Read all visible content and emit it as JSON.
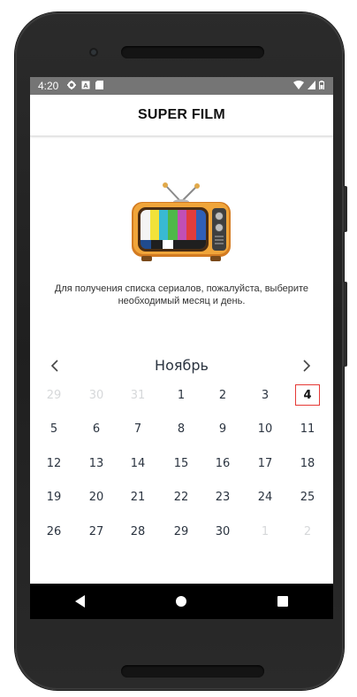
{
  "status_bar": {
    "time": "4:20",
    "left_icons": [
      "settings-icon",
      "a-icon",
      "sd-card-icon"
    ],
    "right_icons": [
      "wifi-icon",
      "signal-icon",
      "battery-icon"
    ]
  },
  "app_bar": {
    "title": "SUPER FILM"
  },
  "instruction_text": "Для получения списка сериалов, пожалуйста, выберите необходимый месяц и день.",
  "calendar": {
    "month": "Ноябрь",
    "prev_label": "<",
    "next_label": ">",
    "selected_day": "4",
    "weeks": [
      [
        {
          "d": "29",
          "dim": true
        },
        {
          "d": "30",
          "dim": true
        },
        {
          "d": "31",
          "dim": true
        },
        {
          "d": "1"
        },
        {
          "d": "2"
        },
        {
          "d": "3"
        },
        {
          "d": "4",
          "sel": true
        }
      ],
      [
        {
          "d": "5"
        },
        {
          "d": "6"
        },
        {
          "d": "7"
        },
        {
          "d": "8"
        },
        {
          "d": "9"
        },
        {
          "d": "10"
        },
        {
          "d": "11"
        }
      ],
      [
        {
          "d": "12"
        },
        {
          "d": "13"
        },
        {
          "d": "14"
        },
        {
          "d": "15"
        },
        {
          "d": "16"
        },
        {
          "d": "17"
        },
        {
          "d": "18"
        }
      ],
      [
        {
          "d": "19"
        },
        {
          "d": "20"
        },
        {
          "d": "21"
        },
        {
          "d": "22"
        },
        {
          "d": "23"
        },
        {
          "d": "24"
        },
        {
          "d": "25"
        }
      ],
      [
        {
          "d": "26"
        },
        {
          "d": "27"
        },
        {
          "d": "28"
        },
        {
          "d": "29"
        },
        {
          "d": "30"
        },
        {
          "d": "1",
          "dim": true
        },
        {
          "d": "2",
          "dim": true
        }
      ]
    ]
  },
  "nav_bar": {
    "buttons": [
      "back-icon",
      "home-icon",
      "recents-icon"
    ]
  },
  "colors": {
    "selected_border": "#e53935",
    "dim_day": "#d6d8da",
    "day_text": "#2b3440",
    "status_bar": "#757575"
  }
}
